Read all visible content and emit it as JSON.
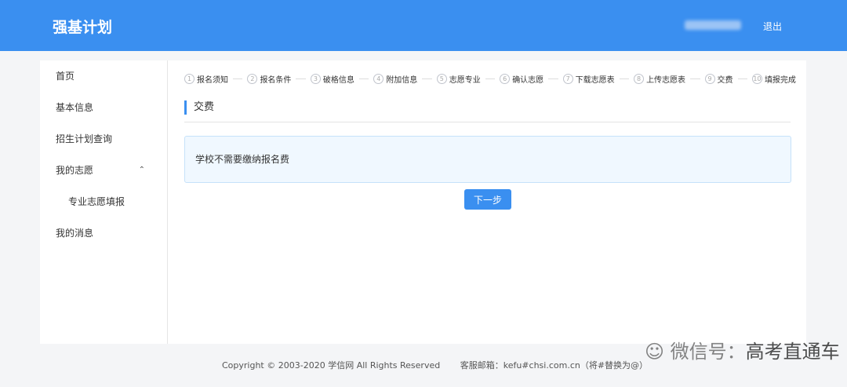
{
  "header": {
    "title": "强基计划",
    "logout": "退出"
  },
  "sidebar": {
    "items": [
      {
        "label": "首页"
      },
      {
        "label": "基本信息"
      },
      {
        "label": "招生计划查询"
      },
      {
        "label": "我的志愿"
      },
      {
        "label": "专业志愿填报"
      },
      {
        "label": "我的消息"
      }
    ]
  },
  "steps": [
    {
      "num": "1",
      "label": "报名须知"
    },
    {
      "num": "2",
      "label": "报名条件"
    },
    {
      "num": "3",
      "label": "破格信息"
    },
    {
      "num": "4",
      "label": "附加信息"
    },
    {
      "num": "5",
      "label": "志愿专业"
    },
    {
      "num": "6",
      "label": "确认志愿"
    },
    {
      "num": "7",
      "label": "下载志愿表"
    },
    {
      "num": "8",
      "label": "上传志愿表"
    },
    {
      "num": "9",
      "label": "交费"
    },
    {
      "num": "10",
      "label": "填报完成"
    }
  ],
  "section": {
    "title": "交费",
    "notice": "学校不需要缴纳报名费",
    "next": "下一步"
  },
  "footer": {
    "copyright": "Copyright © 2003-2020 学信网 All Rights Reserved",
    "email": "客服邮箱：kefu#chsi.com.cn（将#替换为@）"
  },
  "watermark": {
    "prefix": "微信号：",
    "name": "高考直通车"
  }
}
